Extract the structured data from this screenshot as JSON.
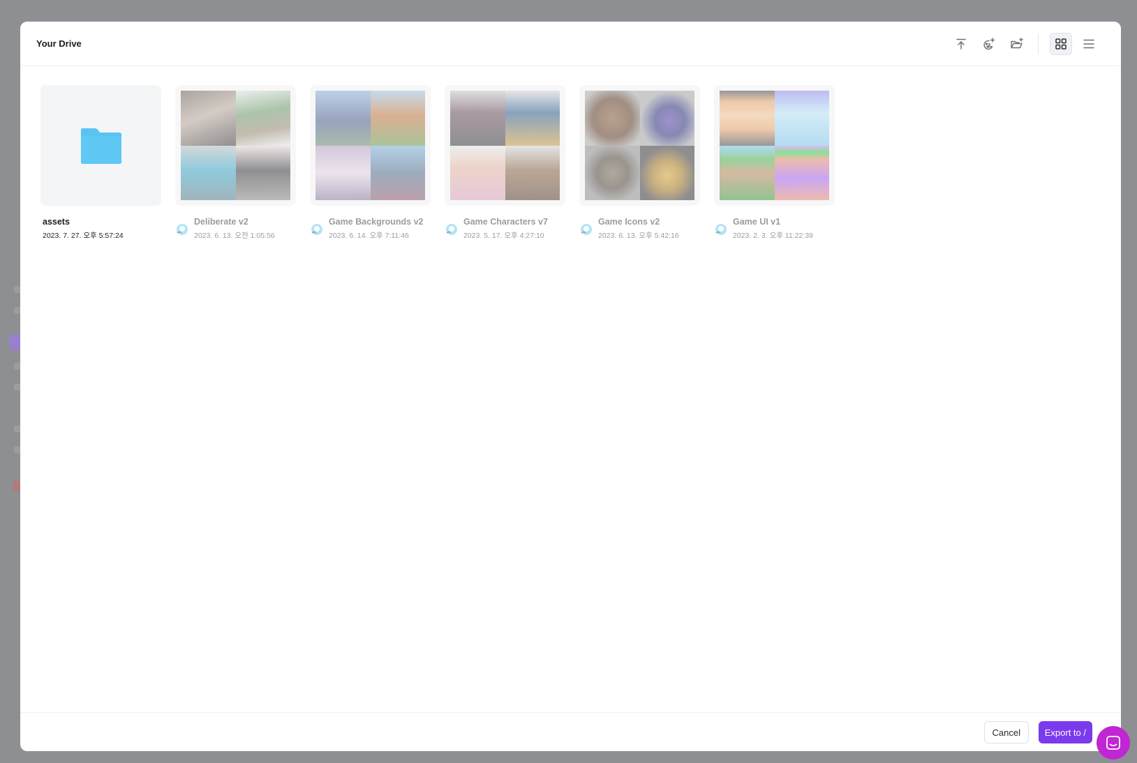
{
  "modal": {
    "title": "Your Drive"
  },
  "toolbar": {
    "buttons": [
      {
        "name": "upload-icon"
      },
      {
        "name": "add-model-icon"
      },
      {
        "name": "new-folder-icon"
      },
      {
        "name": "grid-view-icon",
        "active": true
      },
      {
        "name": "list-view-icon",
        "active": false
      }
    ]
  },
  "items": [
    {
      "type": "folder",
      "name": "assets",
      "date": "2023. 7. 27. 오후 5:57:24"
    },
    {
      "type": "model",
      "name": "Deliberate v2",
      "date": "2023. 6. 13. 오전 1:05:56"
    },
    {
      "type": "model",
      "name": "Game Backgrounds v2",
      "date": "2023. 6. 14. 오후 7:11:46"
    },
    {
      "type": "model",
      "name": "Game Characters v7",
      "date": "2023. 5. 17. 오후 4:27:10"
    },
    {
      "type": "model",
      "name": "Game Icons v2",
      "date": "2023. 6. 13. 오후 5:42:16"
    },
    {
      "type": "model",
      "name": "Game UI v1",
      "date": "2023. 2. 3. 오후 11:22:39"
    }
  ],
  "footer": {
    "cancel_label": "Cancel",
    "export_label": "Export to /"
  },
  "colors": {
    "accent": "#7c3aed",
    "folder": "#38bdf8",
    "chat": "#c026d3"
  }
}
